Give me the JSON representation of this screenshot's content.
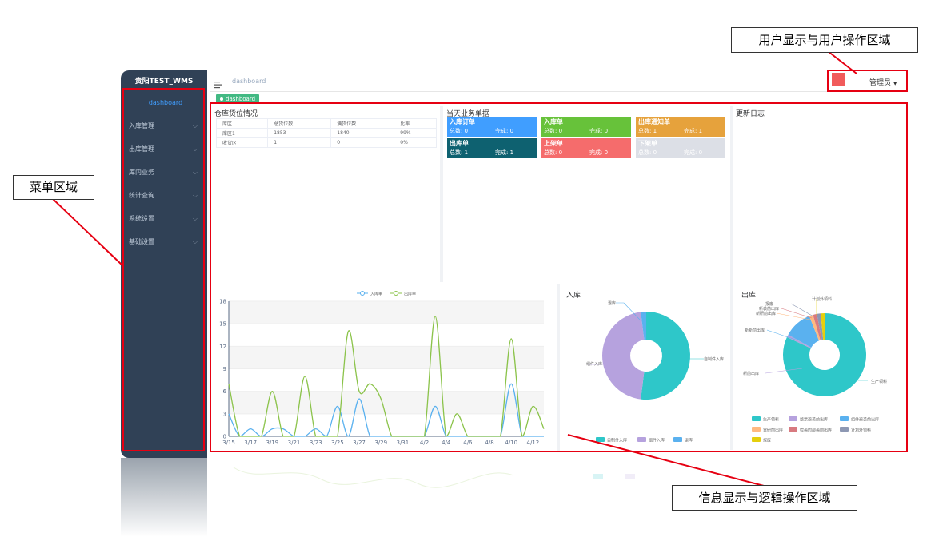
{
  "annotations": {
    "user_area": "用户显示与用户操作区域",
    "menu_area": "菜单区域",
    "info_area": "信息显示与逻辑操作区域"
  },
  "sidebar": {
    "brand": "贵阳TEST_WMS",
    "active": "dashboard",
    "items": [
      {
        "label": "入库管理"
      },
      {
        "label": "出库管理"
      },
      {
        "label": "库内业务"
      },
      {
        "label": "统计查询"
      },
      {
        "label": "系统设置"
      },
      {
        "label": "基础设置"
      }
    ]
  },
  "header": {
    "breadcrumb": "dashboard",
    "user": "管理员",
    "tag": "dashboard",
    "hamburger_icon": "hamburger-icon",
    "avatar_color": "#f15b5b"
  },
  "warehouse": {
    "title": "仓库货位情况",
    "columns": [
      "库区",
      "总货位数",
      "满货位数",
      "比率"
    ],
    "rows": [
      [
        "库区1",
        "1853",
        "1840",
        "99%"
      ],
      [
        "收货区",
        "1",
        "0",
        "0%"
      ]
    ]
  },
  "orders": {
    "title": "当天业务单据",
    "total_label": "总数:",
    "done_label": "完成:",
    "cards": [
      {
        "title": "入库订单",
        "total": "0",
        "done": "0",
        "color": "#409eff"
      },
      {
        "title": "入库单",
        "total": "0",
        "done": "0",
        "color": "#67c23a"
      },
      {
        "title": "出库通知单",
        "total": "1",
        "done": "1",
        "color": "#e6a23c"
      },
      {
        "title": "出库单",
        "total": "1",
        "done": "1",
        "color": "#0e6170"
      },
      {
        "title": "上架单",
        "total": "0",
        "done": "0",
        "color": "#f56c6c"
      },
      {
        "title": "下架单",
        "total": "0",
        "done": "0",
        "color": "#dcdfe6"
      }
    ]
  },
  "update_log": {
    "title": "更新日志"
  },
  "chart_data": [
    {
      "type": "line",
      "legend": [
        "入库单",
        "出库单"
      ],
      "x": [
        "3/15",
        "3/16",
        "3/17",
        "3/18",
        "3/19",
        "3/20",
        "3/21",
        "3/22",
        "3/23",
        "3/24",
        "3/25",
        "3/26",
        "3/27",
        "3/28",
        "3/29",
        "3/30",
        "3/31",
        "4/1",
        "4/2",
        "4/3",
        "4/4",
        "4/5",
        "4/6",
        "4/7",
        "4/8",
        "4/9",
        "4/10",
        "4/11",
        "4/12",
        "4/13"
      ],
      "x_ticks": [
        "3/15",
        "3/17",
        "3/19",
        "3/21",
        "3/23",
        "3/25",
        "3/27",
        "3/29",
        "3/31",
        "4/2",
        "4/4",
        "4/6",
        "4/8",
        "4/10",
        "4/12"
      ],
      "ylim": [
        0,
        18
      ],
      "y_ticks": [
        0,
        3,
        6,
        9,
        12,
        15,
        18
      ],
      "series": [
        {
          "name": "入库单",
          "color": "#5ab1ef",
          "values": [
            3,
            0,
            1,
            0,
            1,
            1,
            0,
            0,
            1,
            0,
            4,
            0,
            5,
            0,
            0,
            0,
            0,
            0,
            0,
            4,
            0,
            0,
            0,
            0,
            0,
            0,
            7,
            0,
            0,
            0
          ]
        },
        {
          "name": "出库单",
          "color": "#8bc34a",
          "values": [
            7,
            0,
            0,
            0,
            6,
            0,
            0,
            8,
            0,
            0,
            0,
            14,
            6,
            7,
            5,
            0,
            0,
            0,
            0,
            16,
            0,
            3,
            0,
            0,
            0,
            0,
            13,
            0,
            4,
            1
          ]
        }
      ]
    },
    {
      "type": "pie",
      "title": "入库",
      "legend": [
        "自制件入库",
        "组件入库",
        "退库"
      ],
      "slices": [
        {
          "name": "自制件入库",
          "value": 52,
          "color": "#2ec7c9"
        },
        {
          "name": "组件入库",
          "value": 46,
          "color": "#b6a2de"
        },
        {
          "name": "退库",
          "value": 2,
          "color": "#5ab1ef"
        }
      ]
    },
    {
      "type": "pie",
      "title": "出库",
      "legend": [
        "生产领料",
        "整票避袭前出库",
        "组件避袭前出库",
        "营研前出库",
        "检袭的部袭前出库",
        "计划外领料",
        "报废"
      ],
      "slices": [
        {
          "name": "生产领料",
          "value": 82,
          "color": "#2ec7c9"
        },
        {
          "name": "整票避袭前出库",
          "value": 1,
          "color": "#b6a2de"
        },
        {
          "name": "组件避袭前出库",
          "value": 11,
          "color": "#5ab1ef"
        },
        {
          "name": "营研前出库",
          "value": 1.5,
          "color": "#ffb980"
        },
        {
          "name": "检袭的部袭前出库",
          "value": 1.5,
          "color": "#d87a80"
        },
        {
          "name": "计划外领料",
          "value": 1.5,
          "color": "#8d98b3"
        },
        {
          "name": "报废",
          "value": 1.5,
          "color": "#e5cf0d"
        }
      ],
      "outer_labels": [
        "生产领料",
        "新前出库",
        "新新前出库",
        "计划外领料",
        "报废",
        "新袭前出库",
        "新研前出库"
      ]
    }
  ]
}
